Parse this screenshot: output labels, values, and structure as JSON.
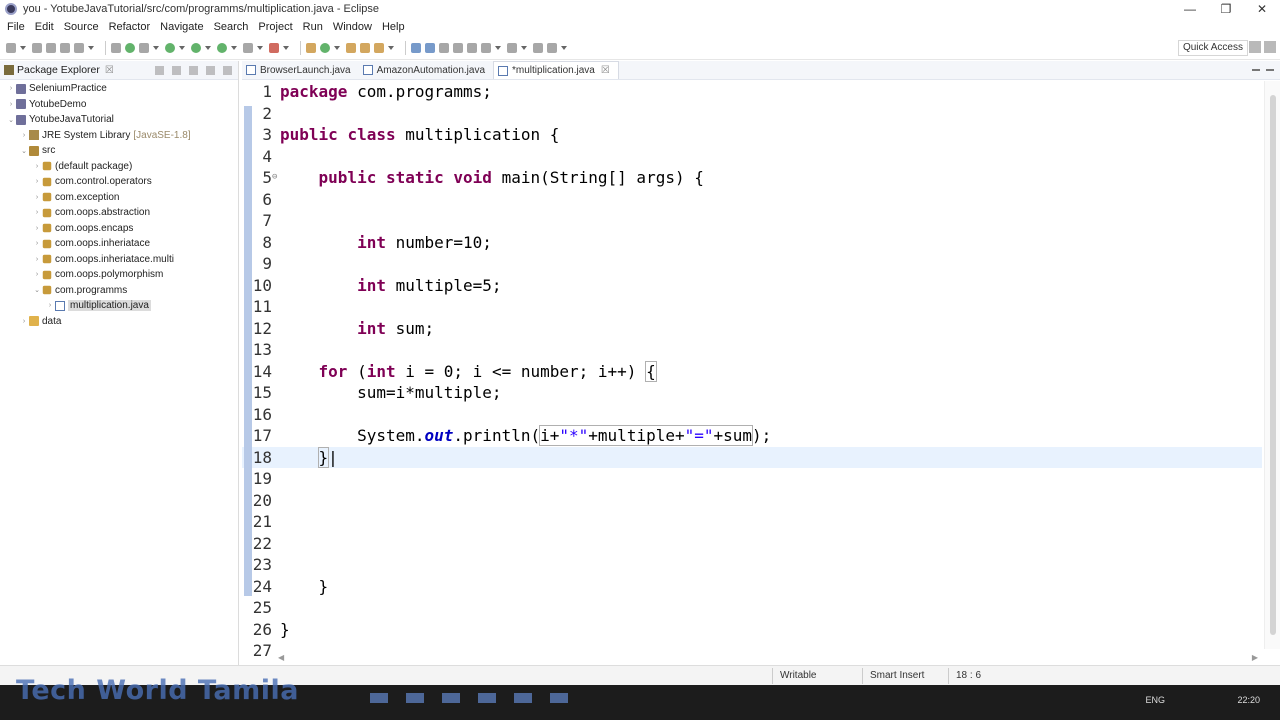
{
  "window": {
    "title": "you - YotubeJavaTutorial/src/com/programms/multiplication.java - Eclipse",
    "minimize": "—",
    "maximize": "❐",
    "close": "✕"
  },
  "menu": [
    "File",
    "Edit",
    "Source",
    "Refactor",
    "Navigate",
    "Search",
    "Project",
    "Run",
    "Window",
    "Help"
  ],
  "toolbar": {
    "quick_access": "Quick Access"
  },
  "package_explorer": {
    "title": "Package Explorer",
    "close": "☒",
    "tree": [
      {
        "label": "SeleniumPractice",
        "arrow": "›",
        "icon": "proj",
        "indent": 0
      },
      {
        "label": "YotubeDemo",
        "arrow": "›",
        "icon": "proj",
        "indent": 0
      },
      {
        "label": "YotubeJavaTutorial",
        "arrow": "⌄",
        "icon": "proj",
        "indent": 0
      },
      {
        "label": "JRE System Library",
        "extra": "[JavaSE-1.8]",
        "arrow": "›",
        "icon": "lib",
        "indent": 1
      },
      {
        "label": "src",
        "arrow": "⌄",
        "icon": "src",
        "indent": 1
      },
      {
        "label": "(default package)",
        "arrow": "›",
        "icon": "pkg",
        "indent": 2
      },
      {
        "label": "com.control.operators",
        "arrow": "›",
        "icon": "pkg",
        "indent": 2
      },
      {
        "label": "com.exception",
        "arrow": "›",
        "icon": "pkg",
        "indent": 2
      },
      {
        "label": "com.oops.abstraction",
        "arrow": "›",
        "icon": "pkg",
        "indent": 2
      },
      {
        "label": "com.oops.encaps",
        "arrow": "›",
        "icon": "pkg",
        "indent": 2
      },
      {
        "label": "com.oops.inheriatace",
        "arrow": "›",
        "icon": "pkg",
        "indent": 2
      },
      {
        "label": "com.oops.inheriatace.multi",
        "arrow": "›",
        "icon": "pkg",
        "indent": 2
      },
      {
        "label": "com.oops.polymorphism",
        "arrow": "›",
        "icon": "pkg",
        "indent": 2
      },
      {
        "label": "com.programms",
        "arrow": "⌄",
        "icon": "pkg",
        "indent": 2
      },
      {
        "label": "multiplication.java",
        "arrow": "›",
        "icon": "java",
        "indent": 3,
        "selected": true
      },
      {
        "label": "data",
        "arrow": "›",
        "icon": "folder",
        "indent": 1
      }
    ]
  },
  "editor": {
    "tabs": [
      {
        "label": "BrowserLaunch.java",
        "active": false
      },
      {
        "label": "AmazonAutomation.java",
        "active": false
      },
      {
        "label": "*multiplication.java",
        "active": true,
        "close": "☒"
      }
    ],
    "lines": [
      {
        "n": "1",
        "html": "<span class=\"kw\">package</span> com.programms;"
      },
      {
        "n": "2",
        "html": ""
      },
      {
        "n": "3",
        "html": "<span class=\"kw\">public</span> <span class=\"kw\">class</span> multiplication {"
      },
      {
        "n": "4",
        "html": ""
      },
      {
        "n": "5",
        "html": "    <span class=\"kw\">public</span> <span class=\"kw\">static</span> <span class=\"kw\">void</span> main(String[] args) {",
        "fold": "⊖"
      },
      {
        "n": "6",
        "html": ""
      },
      {
        "n": "7",
        "html": ""
      },
      {
        "n": "8",
        "html": "        <span class=\"kw\">int</span> number=10;"
      },
      {
        "n": "9",
        "html": ""
      },
      {
        "n": "10",
        "html": "        <span class=\"kw\">int</span> multiple=5;"
      },
      {
        "n": "11",
        "html": ""
      },
      {
        "n": "12",
        "html": "        <span class=\"kw\">int</span> sum;"
      },
      {
        "n": "13",
        "html": ""
      },
      {
        "n": "14",
        "html": "    <span class=\"kw\">for</span> (<span class=\"kw\">int</span> i = 0; i &lt;= number; i++) <span class=\"boxed\">{</span>"
      },
      {
        "n": "15",
        "html": "        sum=i*multiple;"
      },
      {
        "n": "16",
        "html": ""
      },
      {
        "n": "17",
        "html": "        System.<span class=\"it\">out</span>.println(<span class=\"boxed\">i+<span class=\"str\">\"*\"</span>+multiple+<span class=\"str\">\"=\"</span>+sum</span>);"
      },
      {
        "n": "18",
        "html": "    <span class=\"boxed\">}</span>|",
        "current": true
      },
      {
        "n": "19",
        "html": ""
      },
      {
        "n": "20",
        "html": ""
      },
      {
        "n": "21",
        "html": ""
      },
      {
        "n": "22",
        "html": ""
      },
      {
        "n": "23",
        "html": ""
      },
      {
        "n": "24",
        "html": "    }"
      },
      {
        "n": "25",
        "html": ""
      },
      {
        "n": "26",
        "html": "}"
      },
      {
        "n": "27",
        "html": ""
      }
    ]
  },
  "status": {
    "writable": "Writable",
    "insert_mode": "Smart Insert",
    "position": "18 : 6"
  },
  "watermark": "Tech World Tamila",
  "taskbar": {
    "lang": "ENG",
    "clock": "22:20"
  }
}
